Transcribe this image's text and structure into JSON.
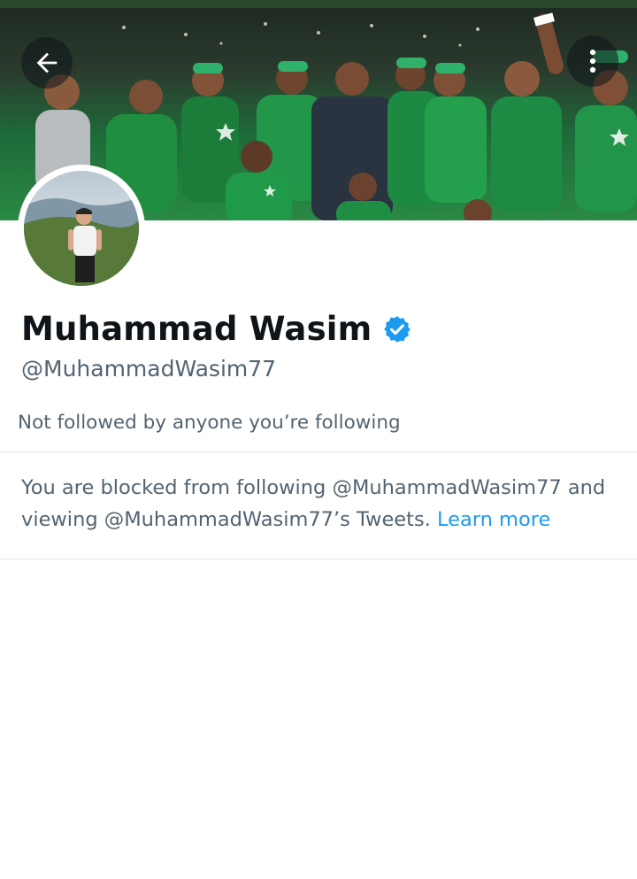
{
  "profile": {
    "display_name": "Muhammad Wasim",
    "handle": "@MuhammadWasim77",
    "verified": true,
    "followers_note": "Not followed by anyone you’re following"
  },
  "blocked_notice": {
    "text": "You are blocked from following @MuhammadWasim77 and viewing @MuhammadWasim77’s Tweets.",
    "link_label": "Learn more"
  },
  "header": {
    "back_icon": "arrow-left-icon",
    "more_icon": "more-vertical-icon"
  },
  "colors": {
    "accent": "#1d9bf0",
    "secondary_text": "#536471",
    "primary_text": "#0f1419",
    "verified_badge": "#1d9bf0",
    "top_strip": "#2a4a2c"
  }
}
